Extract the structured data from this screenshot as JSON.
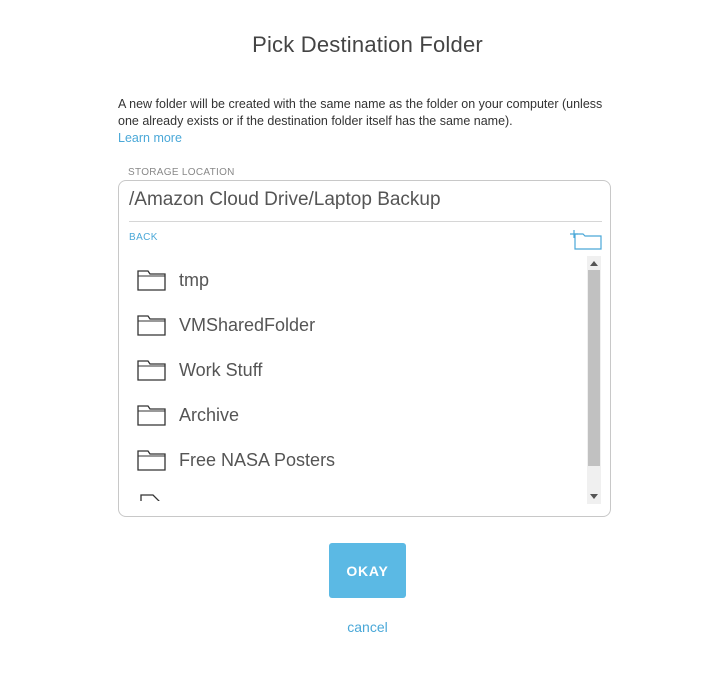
{
  "dialog": {
    "title": "Pick Destination Folder",
    "description": "A new folder will be created with the same name as the folder on your computer (unless one already exists or if the destination folder itself has the same name).",
    "learn_more": "Learn more"
  },
  "storage": {
    "label": "STORAGE LOCATION",
    "path": "/Amazon Cloud Drive/Laptop Backup",
    "back": "BACK",
    "new_folder_icon": "new-folder-icon",
    "folders": [
      {
        "name": "tmp",
        "icon": "folder-icon"
      },
      {
        "name": "VMSharedFolder",
        "icon": "folder-icon"
      },
      {
        "name": "Work Stuff",
        "icon": "folder-icon"
      },
      {
        "name": "Archive",
        "icon": "folder-icon"
      },
      {
        "name": "Free NASA Posters",
        "icon": "folder-icon"
      },
      {
        "name": "",
        "icon": "file-icon"
      }
    ]
  },
  "buttons": {
    "okay": "OKAY",
    "cancel": "cancel"
  },
  "colors": {
    "accent": "#4aa8d8",
    "okay_bg": "#5bb9e4"
  }
}
